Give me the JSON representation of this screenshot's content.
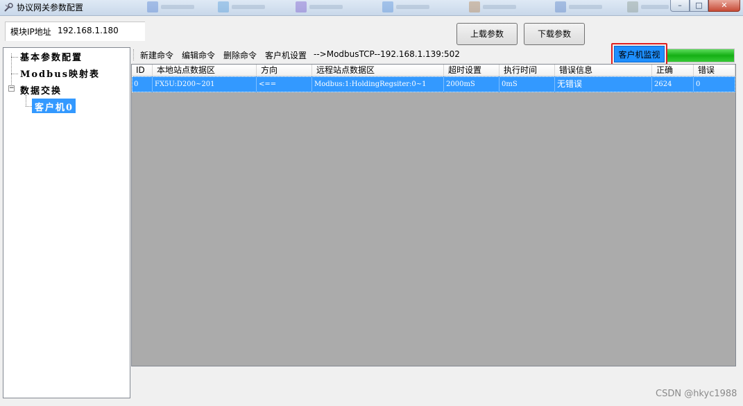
{
  "window": {
    "title": "协议网关参数配置",
    "buttons": {
      "minimize": "–",
      "maximize": "□",
      "close": "✕"
    }
  },
  "header": {
    "ip_label": "模块IP地址",
    "ip_value": "192.168.1.180",
    "upload_label": "上载参数",
    "download_label": "下载参数"
  },
  "tree": {
    "items": [
      {
        "label": "基本参数配置"
      },
      {
        "label": "Modbus映射表"
      },
      {
        "label": "数据交换"
      },
      {
        "label": "客户机0"
      }
    ],
    "expand_glyph": "−"
  },
  "toolbar": {
    "new_command": "新建命令",
    "edit_command": "编辑命令",
    "delete_command": "删除命令",
    "client_settings": "客户机设置",
    "connection": "-->ModbusTCP--192.168.1.139:502",
    "monitor": "客户机监视",
    "progress": 1.0
  },
  "table": {
    "columns": [
      "ID",
      "本地站点数据区",
      "方向",
      "远程站点数据区",
      "超时设置",
      "执行时间",
      "错误信息",
      "正确",
      "错误"
    ],
    "rows": [
      [
        "0",
        "FX5U:D200~201",
        "<==",
        "Modbus:1:HoldingRegsiter:0~1",
        "2000mS",
        "0mS",
        "无错误",
        "2624",
        "0"
      ]
    ]
  },
  "watermark": "CSDN @hkyc1988",
  "colors": {
    "selection": "#3399ff",
    "monitor_button": "#1e8fff",
    "highlight_frame": "#e02020",
    "progress_green": "#15b015",
    "grid_background": "#ababab"
  }
}
